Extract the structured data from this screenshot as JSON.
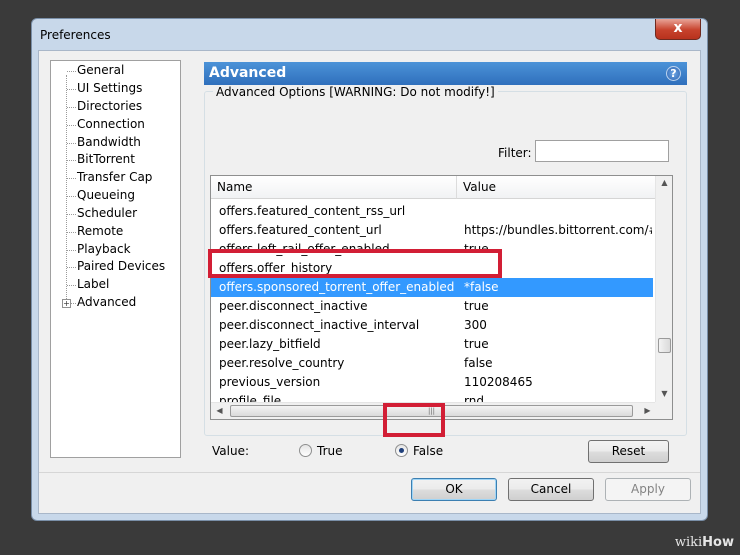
{
  "window": {
    "title": "Preferences",
    "close_label": "x"
  },
  "sidebar": {
    "items": [
      {
        "label": "General"
      },
      {
        "label": "UI Settings"
      },
      {
        "label": "Directories"
      },
      {
        "label": "Connection"
      },
      {
        "label": "Bandwidth"
      },
      {
        "label": "BitTorrent"
      },
      {
        "label": "Transfer Cap"
      },
      {
        "label": "Queueing"
      },
      {
        "label": "Scheduler"
      },
      {
        "label": "Remote"
      },
      {
        "label": "Playback"
      },
      {
        "label": "Paired Devices"
      },
      {
        "label": "Label"
      },
      {
        "label": "Advanced",
        "expander": "+"
      }
    ]
  },
  "panel": {
    "title": "Advanced",
    "help_icon": "?",
    "group_label": "Advanced Options [WARNING: Do not modify!]",
    "filter_label": "Filter:",
    "filter_value": ""
  },
  "table": {
    "columns": [
      "Name",
      "Value"
    ],
    "rows": [
      {
        "name": "offers.featured_content_rss_url",
        "value": ""
      },
      {
        "name": "offers.featured_content_url",
        "value": "https://bundles.bittorrent.com/#..."
      },
      {
        "name": "offers.left_rail_offer_enabled",
        "value": "true"
      },
      {
        "name": "offers.offer_history",
        "value": ""
      },
      {
        "name": "offers.sponsored_torrent_offer_enabled",
        "value": "*false"
      },
      {
        "name": "peer.disconnect_inactive",
        "value": "true"
      },
      {
        "name": "peer.disconnect_inactive_interval",
        "value": "300"
      },
      {
        "name": "peer.lazy_bitfield",
        "value": "true"
      },
      {
        "name": "peer.resolve_country",
        "value": "false"
      },
      {
        "name": "previous_version",
        "value": "110208465"
      },
      {
        "name": "profile_file",
        "value": "rnd"
      }
    ],
    "selected_row": "offers.sponsored_torrent_offer_enabled"
  },
  "value_editor": {
    "label": "Value:",
    "options": [
      {
        "label": "True",
        "selected": false
      },
      {
        "label": "False",
        "selected": true
      }
    ],
    "reset_label": "Reset"
  },
  "footer": {
    "ok_label": "OK",
    "cancel_label": "Cancel",
    "apply_label": "Apply"
  },
  "watermark": {
    "prefix": "wiki",
    "suffix": "How"
  },
  "colors": {
    "selection": "#3399ff",
    "header_blue": "#2f6fbc",
    "highlight_red": "#d21e35"
  }
}
